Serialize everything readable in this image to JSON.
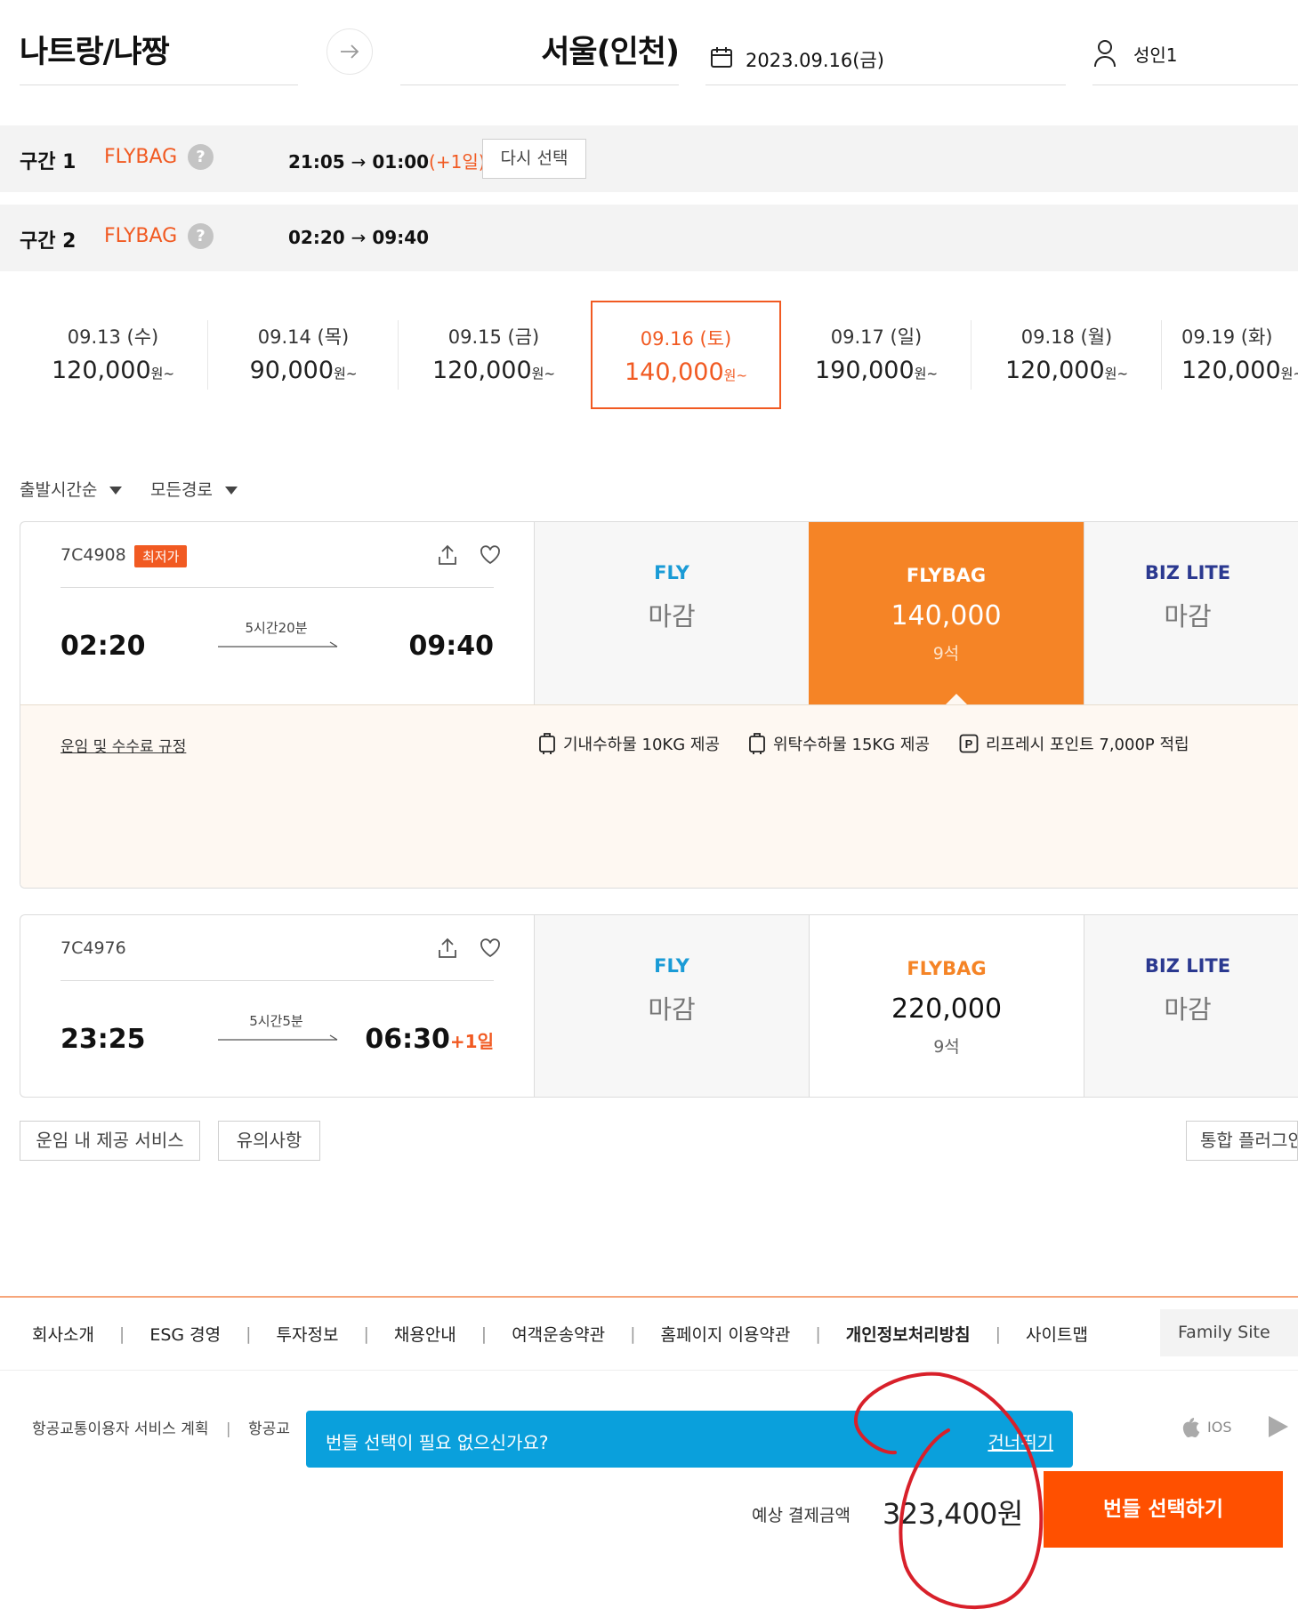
{
  "header": {
    "origin": "나트랑/냐짱",
    "destination": "서울(인천)",
    "date": "2023.09.16(금)",
    "passengers": "성인1"
  },
  "segments": [
    {
      "label": "구간 1",
      "fare": "FLYBAG",
      "help": "?",
      "dep": "21:05",
      "arrow": "→",
      "arr": "01:00",
      "plus": "(+1일)",
      "reselect": "다시 선택"
    },
    {
      "label": "구간 2",
      "fare": "FLYBAG",
      "help": "?",
      "dep": "02:20",
      "arrow": "→",
      "arr": "09:40"
    }
  ],
  "dates": [
    {
      "date": "09.13 (수)",
      "price": "120,000",
      "unit": "원~"
    },
    {
      "date": "09.14 (목)",
      "price": "90,000",
      "unit": "원~"
    },
    {
      "date": "09.15 (금)",
      "price": "120,000",
      "unit": "원~"
    },
    {
      "date": "09.16 (토)",
      "price": "140,000",
      "unit": "원~"
    },
    {
      "date": "09.17 (일)",
      "price": "190,000",
      "unit": "원~"
    },
    {
      "date": "09.18 (월)",
      "price": "120,000",
      "unit": "원~"
    },
    {
      "date": "09.19 (화)",
      "price": "120,000",
      "unit": "원~"
    }
  ],
  "filters": {
    "sort": "출발시간순",
    "route": "모든경로"
  },
  "flights": [
    {
      "number": "7C4908",
      "badge": "최저가",
      "dep": "02:20",
      "arr": "09:40",
      "plus": "",
      "duration": "5시간20분",
      "fares": {
        "fly": {
          "name": "FLY",
          "status": "마감"
        },
        "flybag": {
          "name": "FLYBAG",
          "price": "140,000",
          "seats": "9석"
        },
        "bizlite": {
          "name": "BIZ LITE",
          "status": "마감"
        }
      },
      "detail": {
        "rules": "운임 및 수수료 규정",
        "perks": [
          "기내수하물 10KG 제공",
          "위탁수하물 15KG 제공",
          "리프레시 포인트 7,000P 적립"
        ]
      }
    },
    {
      "number": "7C4976",
      "dep": "23:25",
      "arr": "06:30",
      "plus": "+1일",
      "duration": "5시간5분",
      "fares": {
        "fly": {
          "name": "FLY",
          "status": "마감"
        },
        "flybag": {
          "name": "FLYBAG",
          "price": "220,000",
          "seats": "9석"
        },
        "bizlite": {
          "name": "BIZ LITE",
          "status": "마감"
        }
      }
    }
  ],
  "buttons": {
    "services": "운임 내 제공 서비스",
    "notice": "유의사항",
    "plugin": "통합 플러그인"
  },
  "footer": {
    "links": [
      "회사소개",
      "ESG 경영",
      "투자정보",
      "채용안내",
      "여객운송약관",
      "홈페이지 이용약관",
      "개인정보처리방침",
      "사이트맵"
    ],
    "family_site": "Family Site",
    "service_plan": "항공교통이용자 서비스 계획",
    "service_plan2": "항공교",
    "ios": "IOS"
  },
  "toast": {
    "message": "번들 선택이 필요 없으신가요?",
    "skip": "건너뛰기"
  },
  "summary": {
    "label": "예상 결제금액",
    "total": "323,400원",
    "cta": "번들 선택하기"
  },
  "colors": {
    "brand": "#ff5000",
    "accent": "#f15a22",
    "selected_fare": "#f58426",
    "fly": "#1a9bd6",
    "bizlite": "#2b3990",
    "toast": "#0aa0dc",
    "annotation": "#d8202a"
  }
}
